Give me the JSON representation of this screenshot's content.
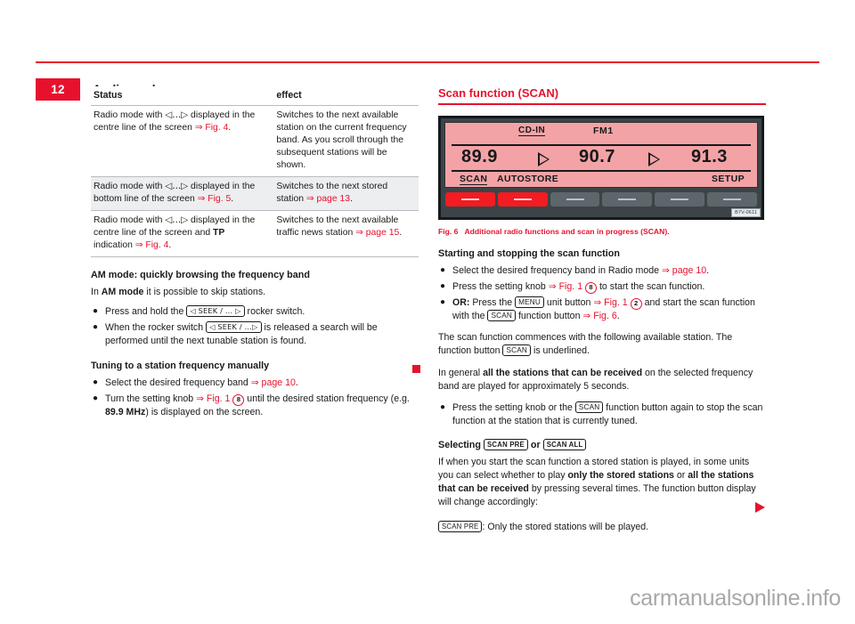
{
  "header": {
    "page_number": "12",
    "title": "Audio mode"
  },
  "left_column": {
    "table": {
      "headers": [
        "Status",
        "effect"
      ],
      "rows": [
        {
          "status_parts": {
            "text_1": "Radio mode with ",
            "glyph": "◁...▷",
            "text_2": " displayed in the centre line of the screen ",
            "ref": "⇒ Fig. 4",
            "text_3": "."
          },
          "effect": "Switches to the next available station on the current frequency band. As you scroll through the subsequent stations will be shown.",
          "shaded": false
        },
        {
          "status_parts": {
            "text_1": "Radio mode with ",
            "glyph": "◁...▷",
            "text_2": " displayed in the bottom line of the screen ",
            "ref": "⇒ Fig. 5",
            "text_3": "."
          },
          "effect_parts": {
            "text_1": "Switches to the next stored station ",
            "ref": "⇒ page 13",
            "text_2": "."
          },
          "shaded": true
        },
        {
          "status_parts": {
            "text_1": "Radio mode with ",
            "glyph": "◁...▷",
            "text_2": " displayed in the centre line of the screen and ",
            "bold": "TP",
            "text_3": " indication ",
            "ref": "⇒ Fig. 4",
            "text_4": "."
          },
          "effect_parts": {
            "text_1": "Switches to the next available traffic news station ",
            "ref": "⇒ page 15",
            "text_2": "."
          },
          "shaded": false
        }
      ]
    },
    "section_am": {
      "heading": "AM mode: quickly browsing the frequency band",
      "intro_1": "In ",
      "intro_bold": "AM mode",
      "intro_2": " it is possible to skip stations.",
      "bullets": [
        {
          "text_1": "Press and hold the ",
          "key": "◁ SEEK / ... ▷",
          "text_2": " rocker switch."
        },
        {
          "text_1": "When the rocker switch ",
          "key": "◁ SEEK / ...▷",
          "text_2": " is released a search will be performed until the next tunable station is found."
        }
      ]
    },
    "section_tuning": {
      "heading": "Tuning to a station frequency manually",
      "bullets": [
        {
          "text_1": "Select the desired frequency band ",
          "ref": "⇒ page 10",
          "text_2": "."
        },
        {
          "text_1": "Turn the setting knob ",
          "ref": "⇒ Fig. 1",
          "callout": "8",
          "text_2": " until the desired station frequency (e.g. ",
          "bold": "89.9 MHz",
          "text_3": ") is displayed on the screen."
        }
      ]
    },
    "end_marker": "red-square"
  },
  "right_column": {
    "section_title": "Scan function (SCAN)",
    "figure": {
      "radio_display": {
        "cd_in": "CD-IN",
        "band": "FM1",
        "frequency_1": "89.9",
        "frequency_2": "90.7",
        "frequency_3": "91.3",
        "fn_scan": "SCAN",
        "fn_autostore": "AUTOSTORE",
        "fn_setup": "SETUP",
        "image_code": "B7V-0611",
        "button_count": 6,
        "active_buttons": 2
      },
      "caption_number": "Fig. 6",
      "caption_text": "Additional radio functions and scan in progress (SCAN)."
    },
    "section_start_stop": {
      "heading": "Starting and stopping the scan function",
      "bullets": [
        {
          "text_1": "Select the desired frequency band in Radio mode ",
          "ref": "⇒ page 10",
          "text_2": "."
        },
        {
          "text_1": "Press the setting knob ",
          "ref": "⇒ Fig. 1",
          "callout": "8",
          "text_2": " to start the scan function."
        },
        {
          "bold_lead": "OR:",
          "text_1": " Press the ",
          "key": "MENU",
          "text_2": " unit button ",
          "ref": "⇒ Fig. 1",
          "callout": "2",
          "text_3": " and start the scan function with the ",
          "key_2": "SCAN",
          "text_4": " function button ",
          "ref_2": "⇒ Fig. 6",
          "text_5": "."
        }
      ]
    },
    "paragraphs": {
      "p1_text_1": "The scan function commences with the following available station. The function button ",
      "p1_key": "SCAN",
      "p1_text_2": " is underlined.",
      "p2_text_1": "In general ",
      "p2_bold": "all the stations that can be received",
      "p2_text_2": " on the selected frequency band are played for approximately 5 seconds."
    },
    "stop_bullet": {
      "text_1": "Press the setting knob or the ",
      "key": "SCAN",
      "text_2": " function button again to stop the scan function at the station that is currently tuned."
    },
    "section_selecting": {
      "heading_1": "Selecting ",
      "heading_key_1": "SCAN PRE",
      "heading_2": " or ",
      "heading_key_2": "SCAN ALL",
      "body_1": "If when you start the scan function a stored station is played, in some units you can select whether to play ",
      "body_bold_1": "only the stored stations",
      "body_2": " or ",
      "body_bold_2": "all the stations that can be received",
      "body_3": " by pressing several times. The function button display will change accordingly:",
      "line_key": "SCAN PRE",
      "line_text": ": Only the stored stations will be played."
    },
    "end_marker": "red-triangle"
  },
  "watermark": "carmanualsonline.info"
}
